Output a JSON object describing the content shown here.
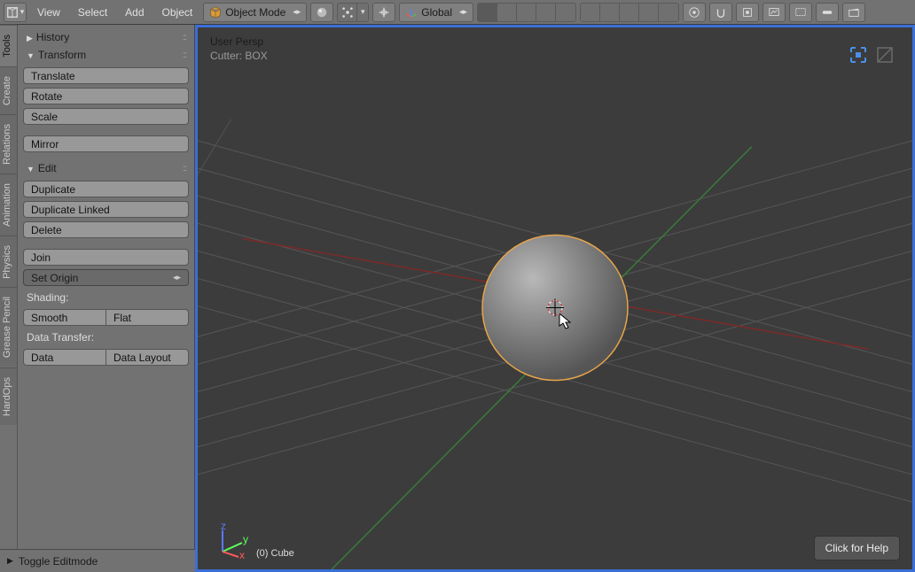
{
  "topbar": {
    "menus": [
      "View",
      "Select",
      "Add",
      "Object"
    ],
    "mode_label": "Object Mode",
    "orientation_label": "Global"
  },
  "vtabs": [
    "Tools",
    "Create",
    "Relations",
    "Animation",
    "Physics",
    "Grease Pencil",
    "HardOps"
  ],
  "panels": {
    "history": {
      "title": "History"
    },
    "transform": {
      "title": "Transform",
      "translate": "Translate",
      "rotate": "Rotate",
      "scale": "Scale",
      "mirror": "Mirror"
    },
    "edit": {
      "title": "Edit",
      "duplicate": "Duplicate",
      "duplicate_linked": "Duplicate Linked",
      "delete": "Delete",
      "join": "Join",
      "set_origin": "Set Origin",
      "shading_label": "Shading:",
      "smooth": "Smooth",
      "flat": "Flat",
      "datatransfer_label": "Data Transfer:",
      "data": "Data",
      "data_layout": "Data Layout"
    }
  },
  "viewport": {
    "persp_label": "User Persp",
    "cutter_label": "Cutter: BOX",
    "object_label": "(0) Cube",
    "help_label": "Click for Help"
  },
  "footer": {
    "toggle_label": "Toggle Editmode"
  }
}
